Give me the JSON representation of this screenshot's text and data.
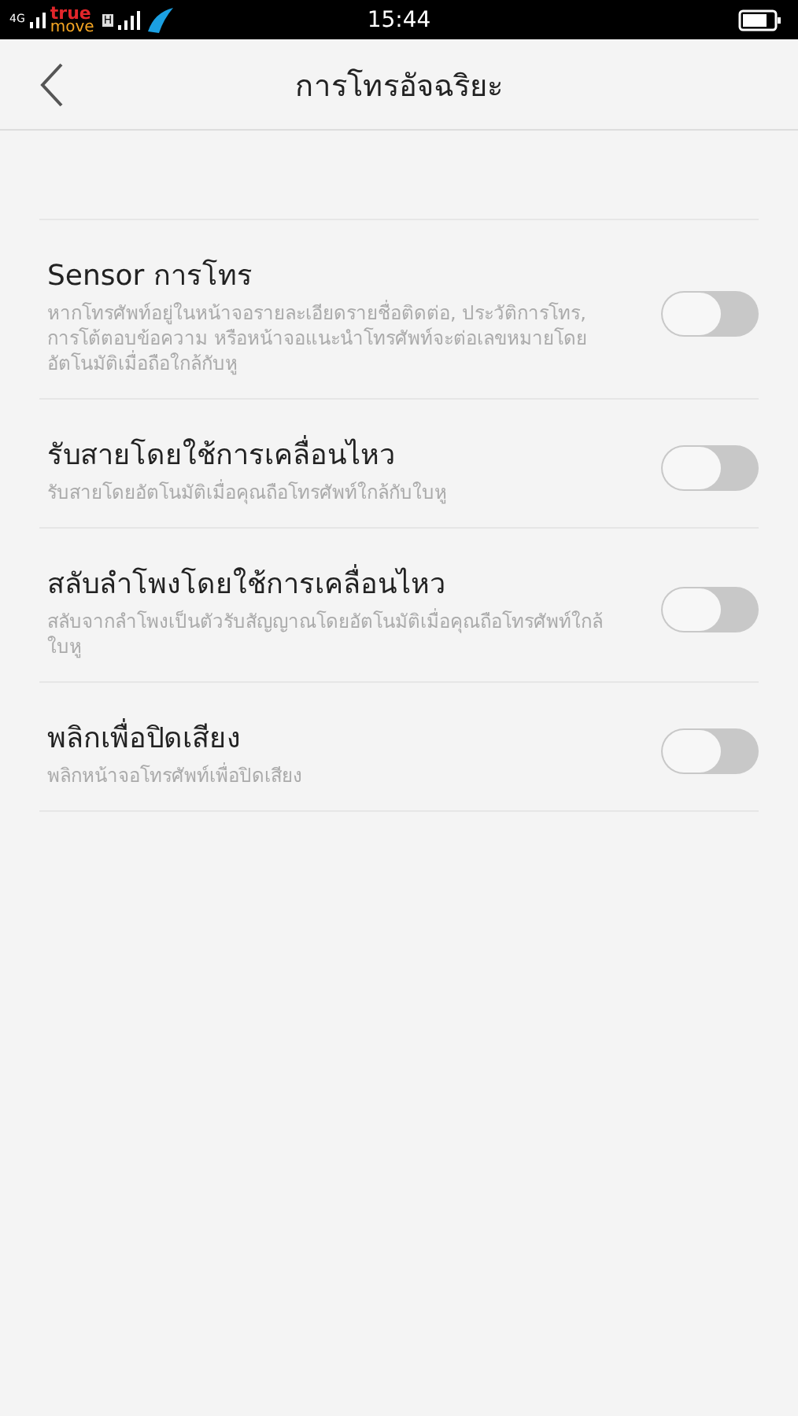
{
  "status_bar": {
    "network": "4G",
    "carrier_top": "true",
    "carrier_bottom": "move",
    "carrier_badge": "H",
    "time": "15:44"
  },
  "header": {
    "title": "การโทรอัจฉริยะ"
  },
  "settings": [
    {
      "title": "Sensor การโทร",
      "description": "หากโทรศัพท์อยู่ในหน้าจอรายละเอียดรายชื่อติดต่อ, ประวัติการโทร, การโต้ตอบข้อความ หรือหน้าจอแนะนำโทรศัพท์จะต่อเลขหมายโดยอัตโนมัติเมื่อถือใกล้กับหู",
      "on": false
    },
    {
      "title": "รับสายโดยใช้การเคลื่อนไหว",
      "description": "รับสายโดยอัตโนมัติเมื่อคุณถือโทรศัพท์ใกล้กับใบหู",
      "on": false
    },
    {
      "title": "สลับลำโพงโดยใช้การเคลื่อนไหว",
      "description": "สลับจากลำโพงเป็นตัวรับสัญญาณโดยอัตโนมัติเมื่อคุณถือโทรศัพท์ใกล้ใบหู",
      "on": false
    },
    {
      "title": "พลิกเพื่อปิดเสียง",
      "description": "พลิกหน้าจอโทรศัพท์เพื่อปิดเสียง",
      "on": false
    }
  ]
}
